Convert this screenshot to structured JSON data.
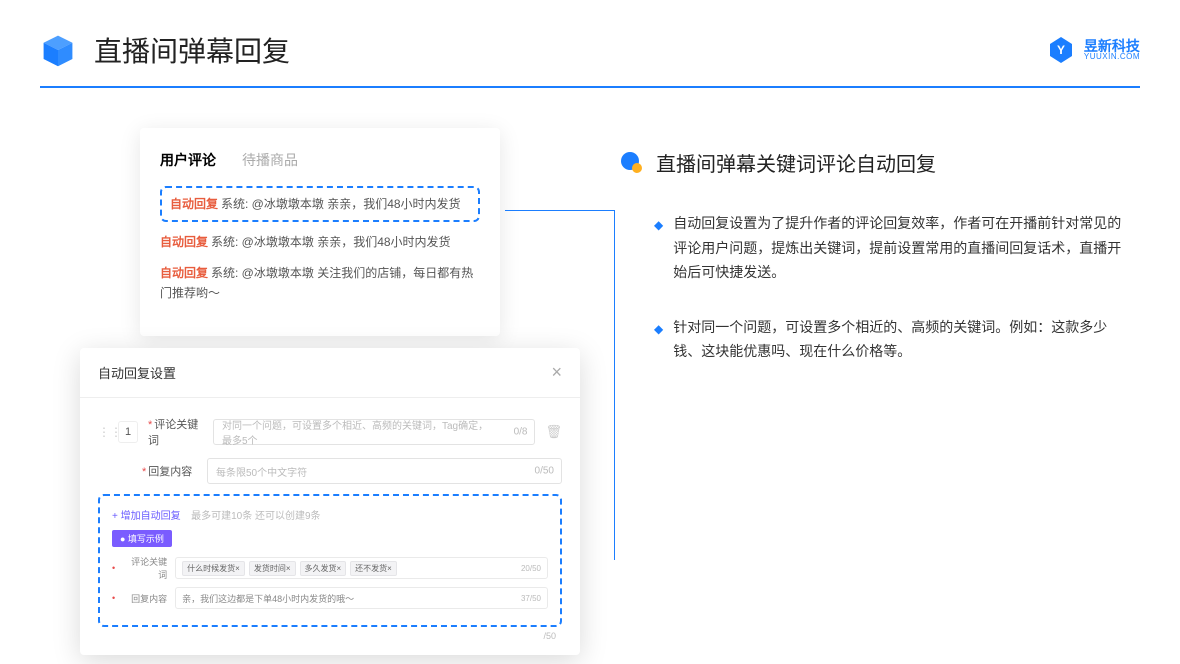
{
  "header": {
    "title": "直播间弹幕回复",
    "brand_cn": "昱新科技",
    "brand_en": "YUUXIN.COM"
  },
  "comments_panel": {
    "tab_active": "用户评论",
    "tab_inactive": "待播商品",
    "highlighted": {
      "tag": "自动回复",
      "text": "系统: @冰墩墩本墩 亲亲，我们48小时内发货"
    },
    "row2": {
      "tag": "自动回复",
      "text": "系统: @冰墩墩本墩 亲亲，我们48小时内发货"
    },
    "row3": {
      "tag": "自动回复",
      "text": "系统: @冰墩墩本墩 关注我们的店铺，每日都有热门推荐哟～"
    }
  },
  "settings": {
    "title": "自动回复设置",
    "row_num": "1",
    "keyword_label": "评论关键词",
    "keyword_placeholder": "对同一个问题，可设置多个相近、高频的关键词，Tag确定，最多5个",
    "keyword_counter": "0/8",
    "content_label": "回复内容",
    "content_placeholder": "每条限50个中文字符",
    "content_counter": "0/50",
    "add_link": "+ 增加自动回复",
    "add_hint": "最多可建10条 还可以创建9条",
    "example_badge": "● 填写示例",
    "ex_kw_label": "评论关键词",
    "ex_tags": [
      "什么时候发货×",
      "发货时间×",
      "多久发货×",
      "还不发货×"
    ],
    "ex_kw_counter": "20/50",
    "ex_ct_label": "回复内容",
    "ex_ct_text": "亲，我们这边都是下单48小时内发货的哦～",
    "ex_ct_counter": "37/50",
    "outer_counter": "/50"
  },
  "right": {
    "title": "直播间弹幕关键词评论自动回复",
    "b1": "自动回复设置为了提升作者的评论回复效率，作者可在开播前针对常见的评论用户问题，提炼出关键词，提前设置常用的直播间回复话术，直播开始后可快捷发送。",
    "b2": "针对同一个问题，可设置多个相近的、高频的关键词。例如：这款多少钱、这块能优惠吗、现在什么价格等。"
  }
}
